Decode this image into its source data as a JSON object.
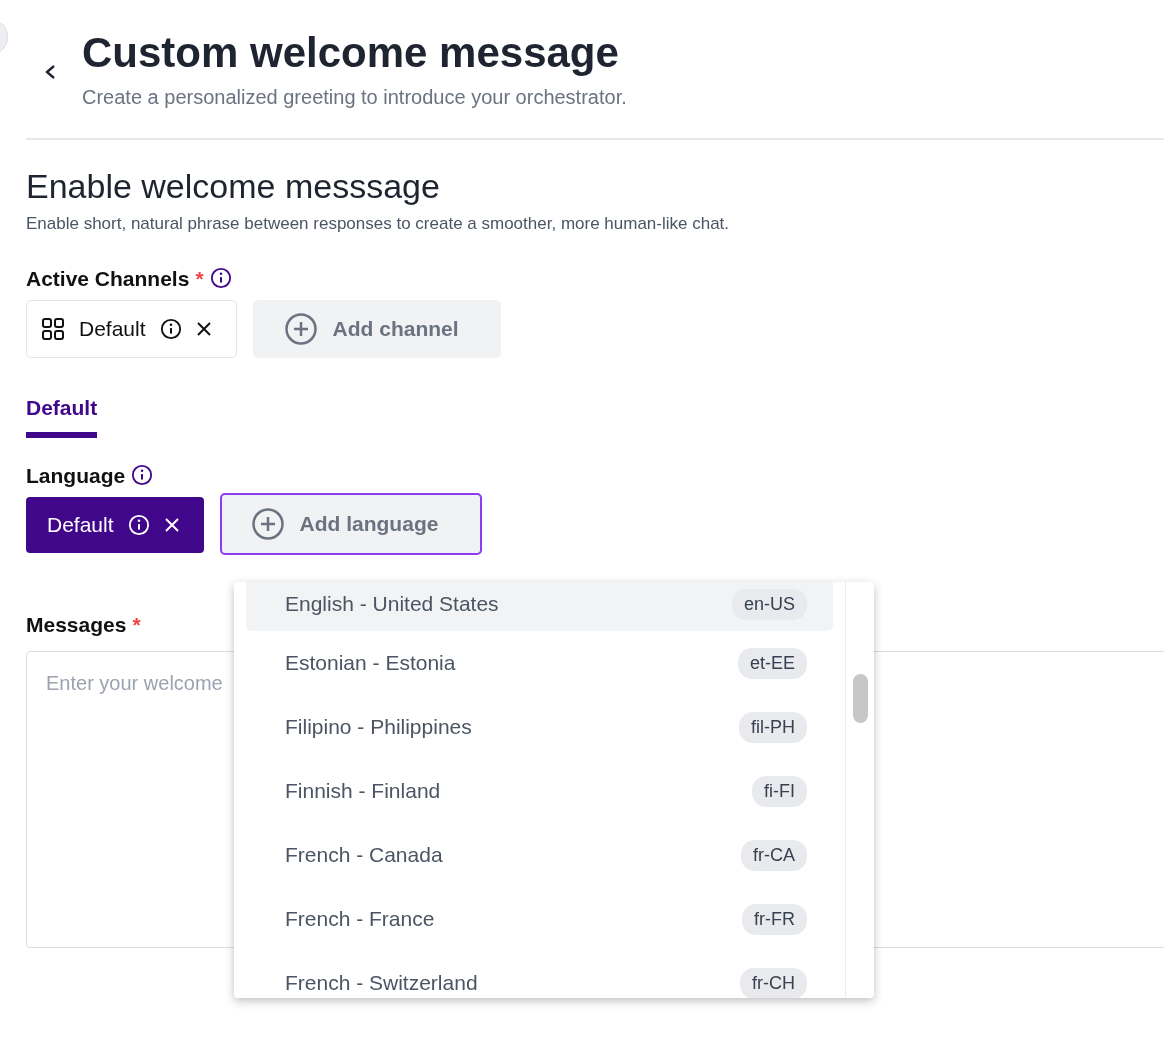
{
  "header": {
    "title": "Custom welcome message",
    "subtitle": "Create a personalized greeting to introduce your orchestrator."
  },
  "section": {
    "title": "Enable welcome messsage",
    "description": "Enable short, natural phrase between responses to create a smoother, more human-like chat."
  },
  "active_channels": {
    "label": "Active Channels",
    "required_mark": "*",
    "chips": [
      {
        "label": "Default"
      }
    ],
    "add_button": {
      "label": "Add channel",
      "focused": false
    }
  },
  "tabs": [
    {
      "label": "Default",
      "selected": true
    }
  ],
  "language": {
    "label": "Language",
    "chips": [
      {
        "label": "Default",
        "selected": true
      }
    ],
    "add_button": {
      "label": "Add language",
      "focused": true
    }
  },
  "messages": {
    "label": "Messages",
    "required_mark": "*",
    "placeholder": "Enter your welcome"
  },
  "dropdown": {
    "options": [
      {
        "label": "English - United States",
        "code": "en-US",
        "highlighted": true
      },
      {
        "label": "Estonian - Estonia",
        "code": "et-EE",
        "highlighted": false
      },
      {
        "label": "Filipino - Philippines",
        "code": "fil-PH",
        "highlighted": false
      },
      {
        "label": "Finnish - Finland",
        "code": "fi-FI",
        "highlighted": false
      },
      {
        "label": "French - Canada",
        "code": "fr-CA",
        "highlighted": false
      },
      {
        "label": "French - France",
        "code": "fr-FR",
        "highlighted": false
      },
      {
        "label": "French - Switzerland",
        "code": "fr-CH",
        "highlighted": false
      }
    ]
  }
}
